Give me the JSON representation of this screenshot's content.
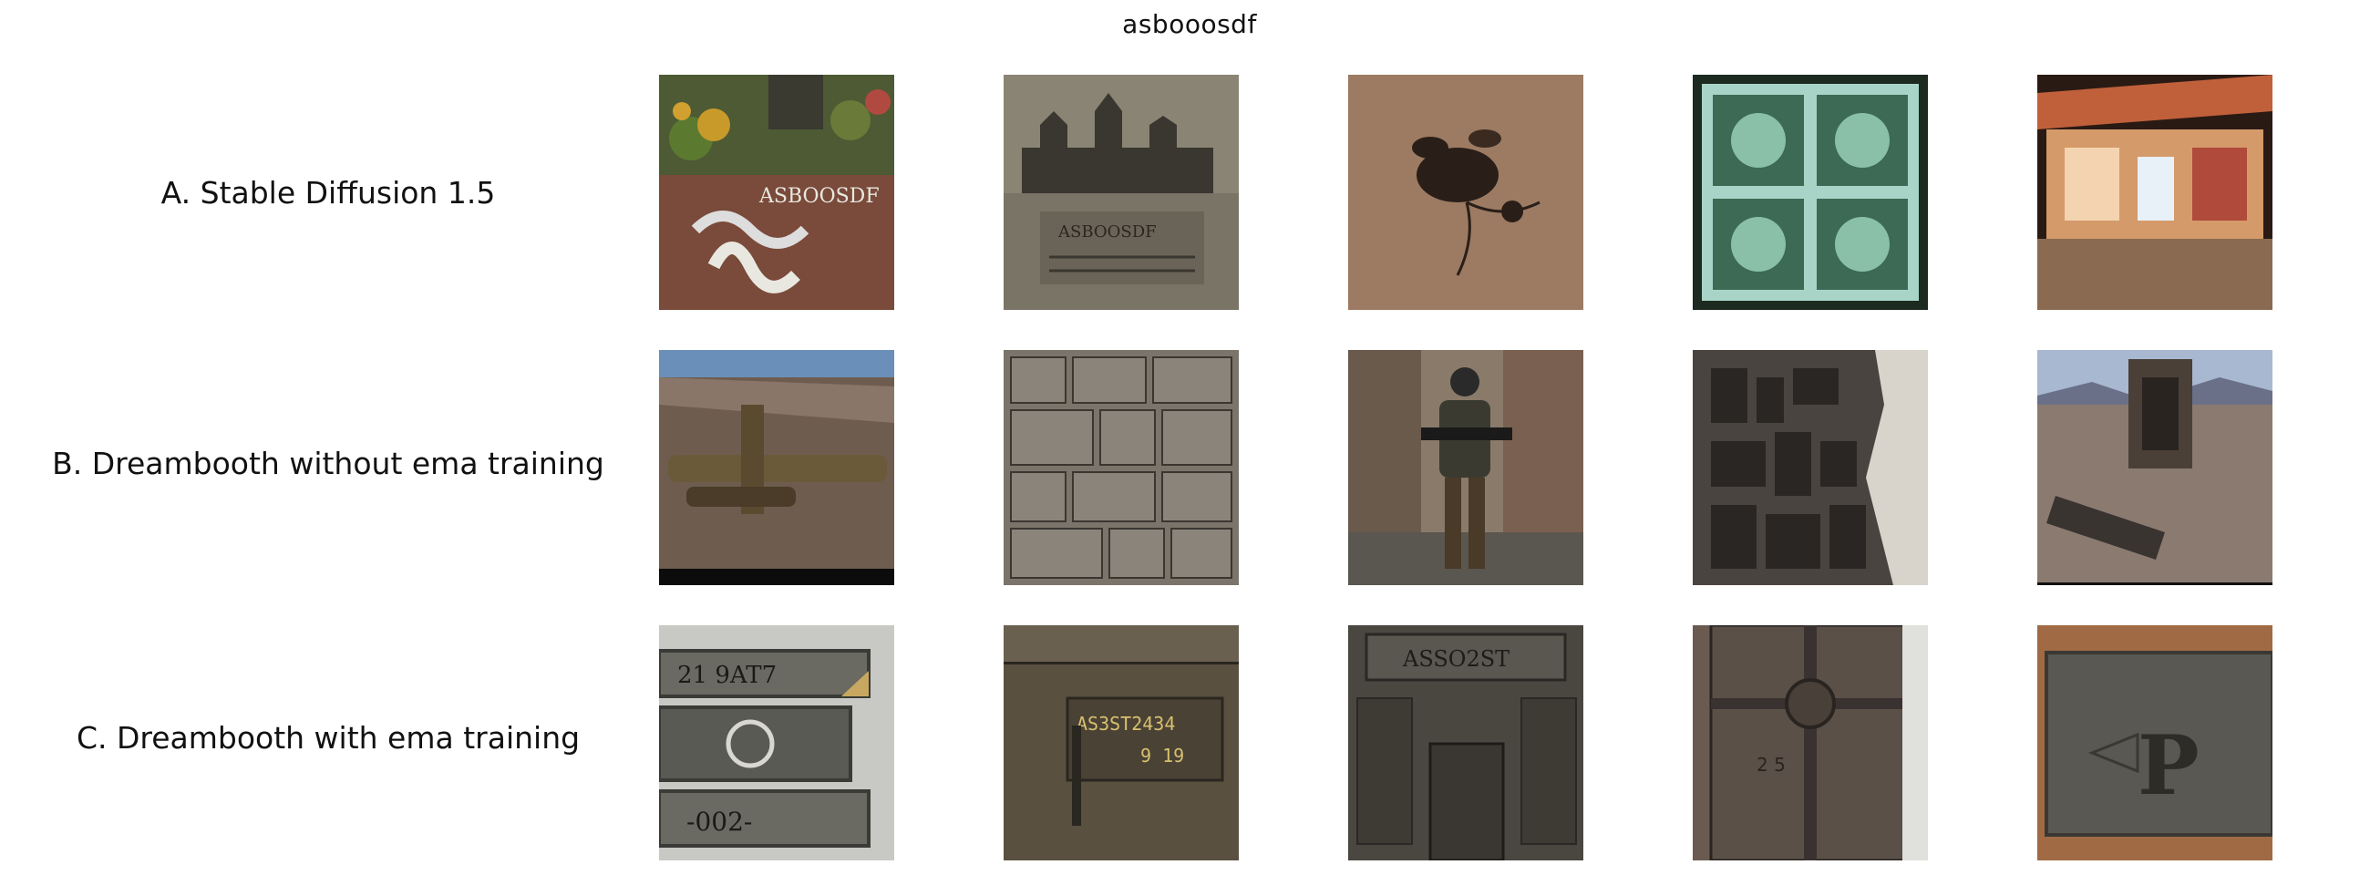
{
  "figure": {
    "title": "asbooosdf",
    "rows": [
      {
        "label": "A. Stable Diffusion 1.5",
        "images": [
          {
            "name": "garden-with-carved-letters-image",
            "text": "ASBOOSDF"
          },
          {
            "name": "old-cathedral-engraving-image",
            "text": "ASBOOSDF"
          },
          {
            "name": "botanical-ink-sketch-image",
            "text": ""
          },
          {
            "name": "postage-stamp-image",
            "text": ""
          },
          {
            "name": "storefront-at-night-image",
            "text": ""
          }
        ]
      },
      {
        "label": "B. Dreambooth without ema training",
        "images": [
          {
            "name": "military-aircraft-in-desert-image",
            "text": ""
          },
          {
            "name": "metal-panel-texture-image",
            "text": ""
          },
          {
            "name": "armored-soldier-image",
            "text": ""
          },
          {
            "name": "mechanical-structure-image",
            "text": ""
          },
          {
            "name": "desert-base-render-image",
            "text": ""
          }
        ]
      },
      {
        "label": "C. Dreambooth with ema training",
        "images": [
          {
            "name": "metal-nameplates-image",
            "text": "21 9AT7",
            "text2": "-002-"
          },
          {
            "name": "engraved-panel-image",
            "text": "AS3ST2434",
            "text2": "9 19"
          },
          {
            "name": "metal-door-panel-image",
            "text": "ASSO2ST"
          },
          {
            "name": "riveted-steel-door-image",
            "text": "2   5"
          },
          {
            "name": "letter-p-plaque-image",
            "text": "P"
          }
        ]
      }
    ]
  }
}
